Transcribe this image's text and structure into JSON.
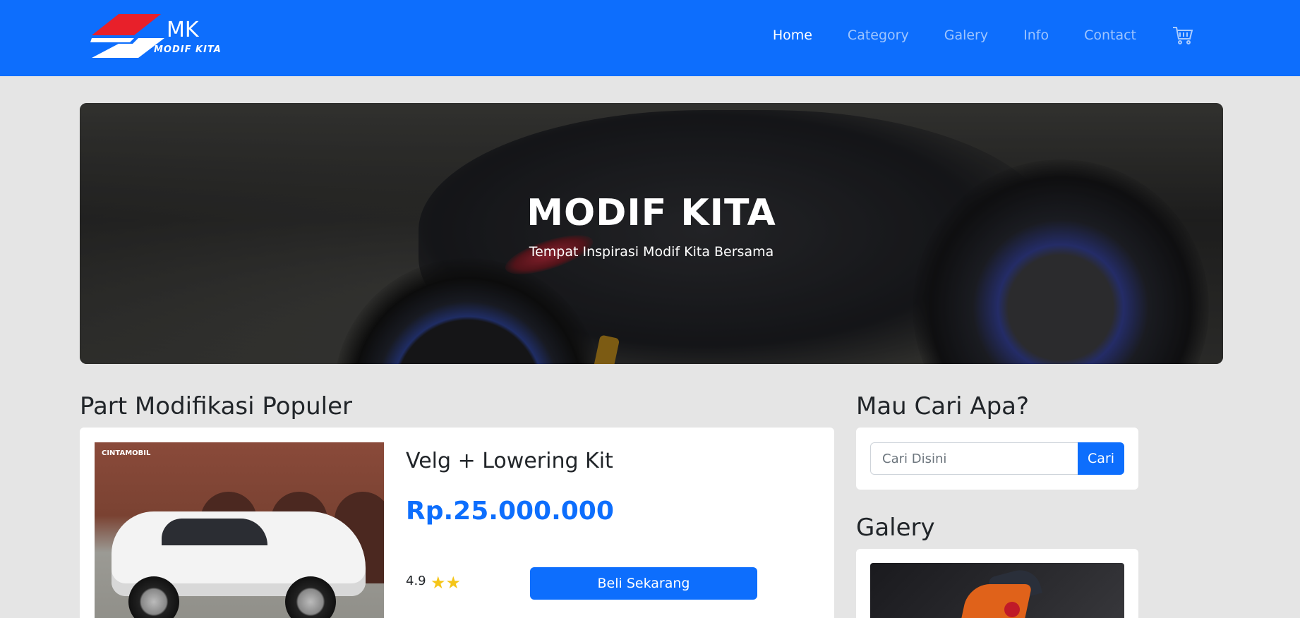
{
  "navbar": {
    "brand": {
      "logo_text": "MK",
      "logo_subtext": "MODIF KITA"
    },
    "links": [
      {
        "label": "Home",
        "active": true
      },
      {
        "label": "Category",
        "active": false
      },
      {
        "label": "Galery",
        "active": false
      },
      {
        "label": "Info",
        "active": false
      },
      {
        "label": "Contact",
        "active": false
      }
    ],
    "cart_icon": "cart-icon"
  },
  "hero": {
    "title": "MODIF KITA",
    "subtitle": "Tempat Inspirasi Modif Kita Bersama"
  },
  "popular": {
    "heading": "Part Modifikasi Populer",
    "product": {
      "name": "Velg + Lowering Kit",
      "price": "Rp.25.000.000",
      "rating": "4.9",
      "stars": "★★",
      "buy_label": "Beli Sekarang",
      "image_watermark": "CINTAMOBIL"
    }
  },
  "search": {
    "heading": "Mau Cari Apa?",
    "placeholder": "Cari Disini",
    "button_label": "Cari"
  },
  "galery": {
    "heading": "Galery"
  },
  "colors": {
    "primary": "#0d6efd",
    "background": "#e5e5e5",
    "star": "#f5c518",
    "logo_red": "#e8202a"
  }
}
